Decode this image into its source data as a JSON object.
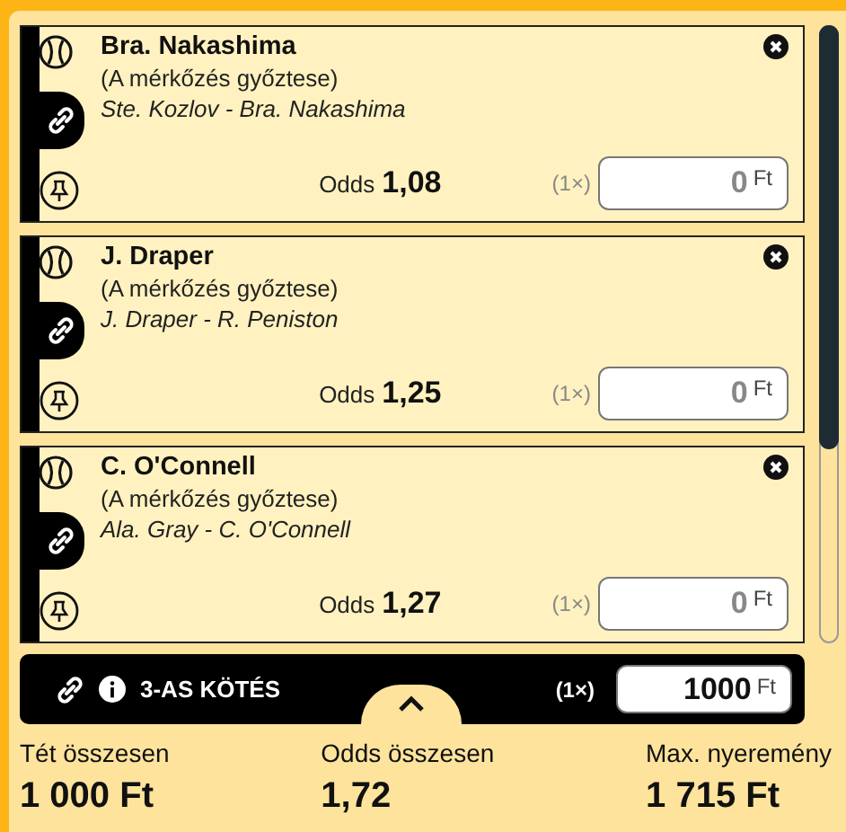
{
  "selections": [
    {
      "player": "Bra. Nakashima",
      "market": "(A mérkőzés győztese)",
      "match": "Ste. Kozlov - Bra. Nakashima",
      "odds_label": "Odds",
      "odds": "1,08",
      "multiplier": "(1×)",
      "stake": "0",
      "currency": "Ft",
      "linked": true
    },
    {
      "player": "J. Draper",
      "market": "(A mérkőzés győztese)",
      "match": "J. Draper - R. Peniston",
      "odds_label": "Odds",
      "odds": "1,25",
      "multiplier": "(1×)",
      "stake": "0",
      "currency": "Ft",
      "linked": true
    },
    {
      "player": "C. O'Connell",
      "market": "(A mérkőzés győztese)",
      "match": "Ala. Gray - C. O'Connell",
      "odds_label": "Odds",
      "odds": "1,27",
      "multiplier": "(1×)",
      "stake": "0",
      "currency": "Ft",
      "linked": true
    }
  ],
  "combo": {
    "title": "3-AS KÖTÉS",
    "multiplier": "(1×)",
    "stake": "1000",
    "currency": "Ft"
  },
  "summary": [
    {
      "label": "Tét összesen",
      "value": "1 000 Ft"
    },
    {
      "label": "Odds összesen",
      "value": "1,72"
    },
    {
      "label": "Max. nyeremény",
      "value": "1 715 Ft"
    }
  ]
}
